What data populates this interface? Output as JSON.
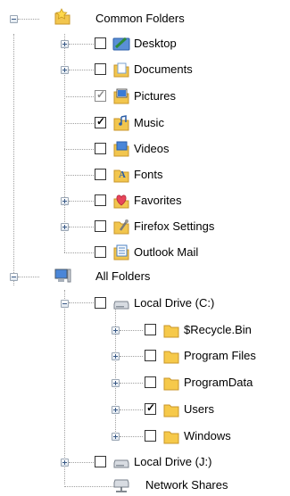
{
  "tree": {
    "common_folders": {
      "label": "Common Folders",
      "items": [
        {
          "label": "Desktop"
        },
        {
          "label": "Documents"
        },
        {
          "label": "Pictures"
        },
        {
          "label": "Music"
        },
        {
          "label": "Videos"
        },
        {
          "label": "Fonts"
        },
        {
          "label": "Favorites"
        },
        {
          "label": "Firefox Settings"
        },
        {
          "label": "Outlook Mail"
        }
      ]
    },
    "all_folders": {
      "label": "All Folders",
      "local_drive_c": {
        "label": "Local Drive (C:)",
        "items": [
          {
            "label": "$Recycle.Bin"
          },
          {
            "label": "Program Files"
          },
          {
            "label": "ProgramData"
          },
          {
            "label": "Users"
          },
          {
            "label": "Windows"
          }
        ]
      },
      "local_drive_j": {
        "label": "Local Drive (J:)"
      },
      "network_shares": {
        "label": "Network Shares"
      }
    }
  },
  "colors": {
    "tree_line": "#a0a0a0",
    "folder_yellow": "#f6c94a",
    "checkbox_border": "#333333"
  }
}
